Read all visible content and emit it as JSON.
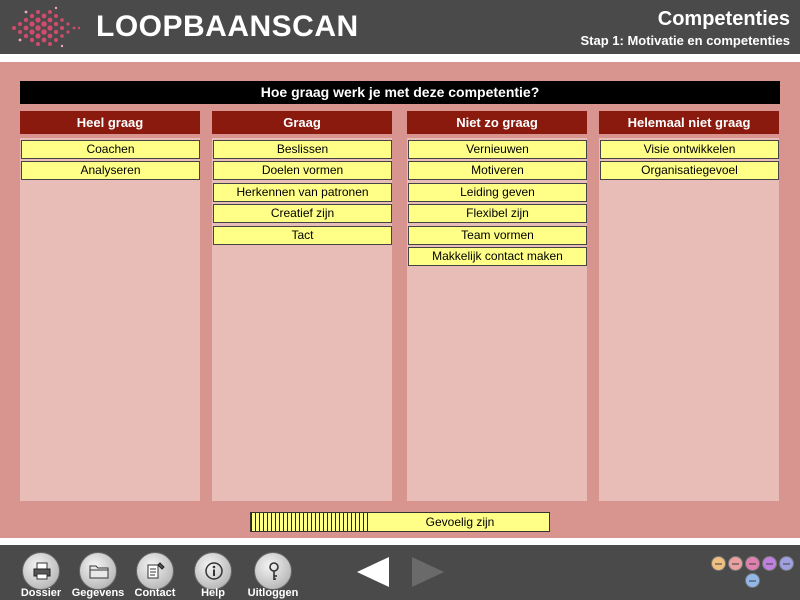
{
  "header": {
    "app_title": "LOOPBAANSCAN",
    "section_title": "Competenties",
    "step_title": "Stap 1: Motivatie en competenties"
  },
  "question": "Hoe graag werk je met deze competentie?",
  "columns": [
    {
      "title": "Heel graag",
      "items": [
        "Coachen",
        "Analyseren"
      ]
    },
    {
      "title": "Graag",
      "items": [
        "Beslissen",
        "Doelen vormen",
        "Herkennen van patronen",
        "Creatief zijn",
        "Tact"
      ]
    },
    {
      "title": "Niet zo graag",
      "items": [
        "Vernieuwen",
        "Motiveren",
        "Leiding geven",
        "Flexibel zijn",
        "Team vormen",
        "Makkelijk contact maken"
      ]
    },
    {
      "title": "Helemaal niet graag",
      "items": [
        "Visie ontwikkelen",
        "Organisatiegevoel"
      ]
    }
  ],
  "current_item": {
    "label": "Gevoelig zijn",
    "progress_fraction": 0.4
  },
  "footer": {
    "buttons": [
      {
        "label": "Dossier",
        "icon": "printer-icon"
      },
      {
        "label": "Gegevens",
        "icon": "folder-icon"
      },
      {
        "label": "Contact",
        "icon": "contact-icon"
      },
      {
        "label": "Help",
        "icon": "info-icon"
      },
      {
        "label": "Uitloggen",
        "icon": "key-icon"
      }
    ],
    "step_dot_colors": [
      "#f0c080",
      "#e8a0a0",
      "#e080b0",
      "#c080e0",
      "#a0a0e0",
      "#90b8e8"
    ]
  },
  "colors": {
    "header_bg": "#4a4a4a",
    "main_bg": "#d8958f",
    "column_header_bg": "#8b1a0e",
    "column_body_bg": "#e8bdb8",
    "item_bg": "#ffff88"
  }
}
